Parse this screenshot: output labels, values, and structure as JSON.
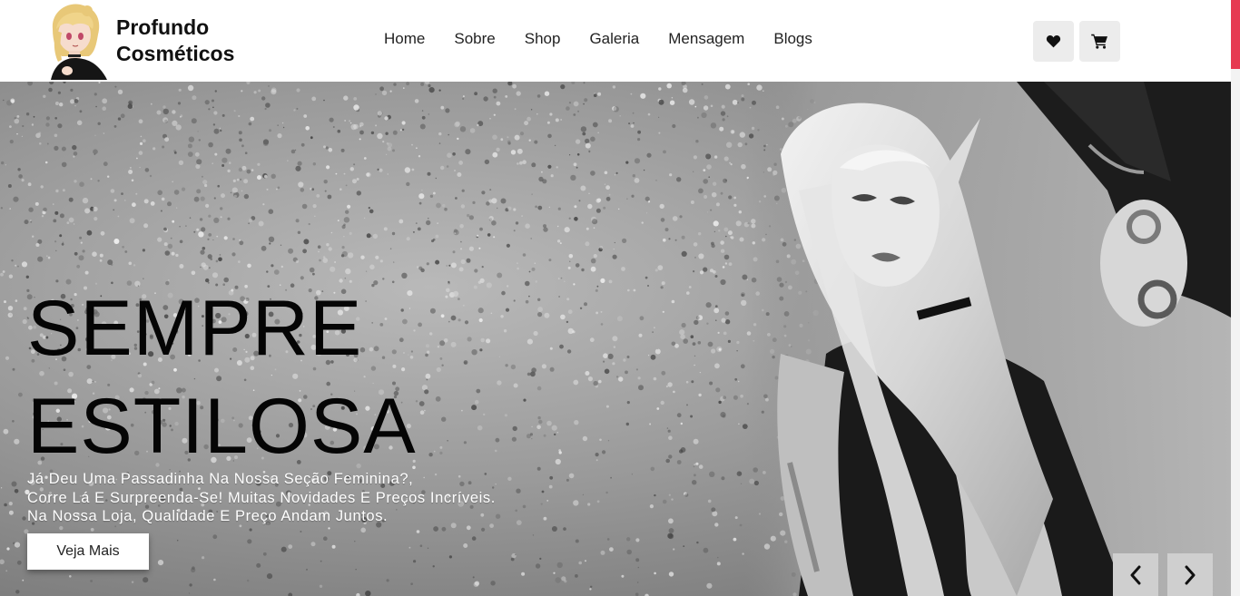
{
  "brand": {
    "line1": "Profundo",
    "line2": "Cosméticos",
    "logo_icon": "anime-girl-avatar-icon"
  },
  "nav": {
    "items": [
      {
        "label": "Home"
      },
      {
        "label": "Sobre"
      },
      {
        "label": "Shop"
      },
      {
        "label": "Galeria"
      },
      {
        "label": "Mensagem"
      },
      {
        "label": "Blogs"
      }
    ]
  },
  "actions": {
    "wishlist_icon": "heart-icon",
    "cart_icon": "cart-icon"
  },
  "hero": {
    "title_line1": "SEMPRE",
    "title_line2": "ESTILOSA",
    "text_line1": "Já Deu Uma Passadinha Na Nossa Seção Feminina?,",
    "text_line2": "Corre Lá E Surpreenda-Se! Muitas Novidades E Preços Incríveis.",
    "text_line3": "Na Nossa Loja, Qualidade E Preço Andam Juntos.",
    "cta_label": "Veja Mais",
    "prev_icon": "chevron-left-icon",
    "next_icon": "chevron-right-icon"
  },
  "colors": {
    "accent": "#e63a52",
    "icon_button_bg": "#ececec",
    "hero_text": "#ffffff",
    "hero_title": "#050505"
  }
}
